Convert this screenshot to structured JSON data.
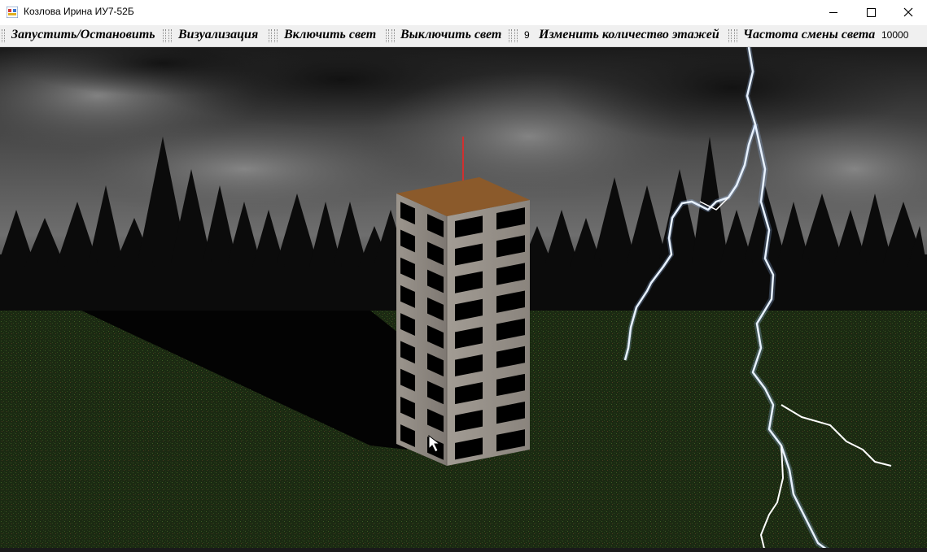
{
  "window": {
    "title": "Козлова Ирина ИУ7-52Б"
  },
  "toolbar": {
    "start_stop": "Запустить/Остановить",
    "visualization": "Визуализация",
    "lights_on": "Включить свет",
    "lights_off": "Выключить свет",
    "floors_value": "9",
    "change_floors": "Изменить количество этажей",
    "light_frequency": "Частота смены света",
    "frequency_value": "10000"
  },
  "colors": {
    "sky": "#3a3a3a",
    "grass": "#1e2e14",
    "roof": "#8b5a2b",
    "wall": "#8f8a84",
    "antenna": "#d03030"
  },
  "icons": [
    "app-icon",
    "minimize-icon",
    "maximize-icon",
    "close-icon"
  ]
}
